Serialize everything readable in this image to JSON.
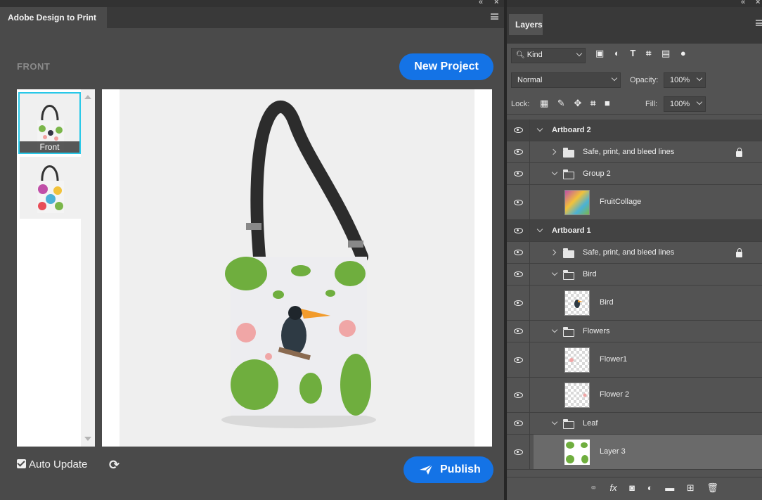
{
  "left_panel": {
    "tab_title": "Adobe Design to Print",
    "side_label": "FRONT",
    "new_project_label": "New Project",
    "thumbnails": [
      {
        "caption": "Front"
      }
    ],
    "auto_update_label": "Auto Update",
    "publish_label": "Publish",
    "accent_color": "#1473e6",
    "selection_color": "#28c8e8"
  },
  "layers_panel": {
    "tab_title": "Layers",
    "filter_kind": "Kind",
    "blend_mode": "Normal",
    "opacity_label": "Opacity:",
    "opacity_value": "100%",
    "lock_label": "Lock:",
    "fill_label": "Fill:",
    "fill_value": "100%",
    "rows": [
      {
        "name": "Artboard 2"
      },
      {
        "name": "Safe, print, and bleed lines"
      },
      {
        "name": "Group 2"
      },
      {
        "name": "FruitCollage"
      },
      {
        "name": "Artboard 1"
      },
      {
        "name": "Safe, print, and bleed lines"
      },
      {
        "name": "Bird"
      },
      {
        "name": "Bird"
      },
      {
        "name": "Flowers"
      },
      {
        "name": "Flower1"
      },
      {
        "name": "Flower 2"
      },
      {
        "name": "Leaf"
      },
      {
        "name": "Layer 3"
      }
    ]
  }
}
